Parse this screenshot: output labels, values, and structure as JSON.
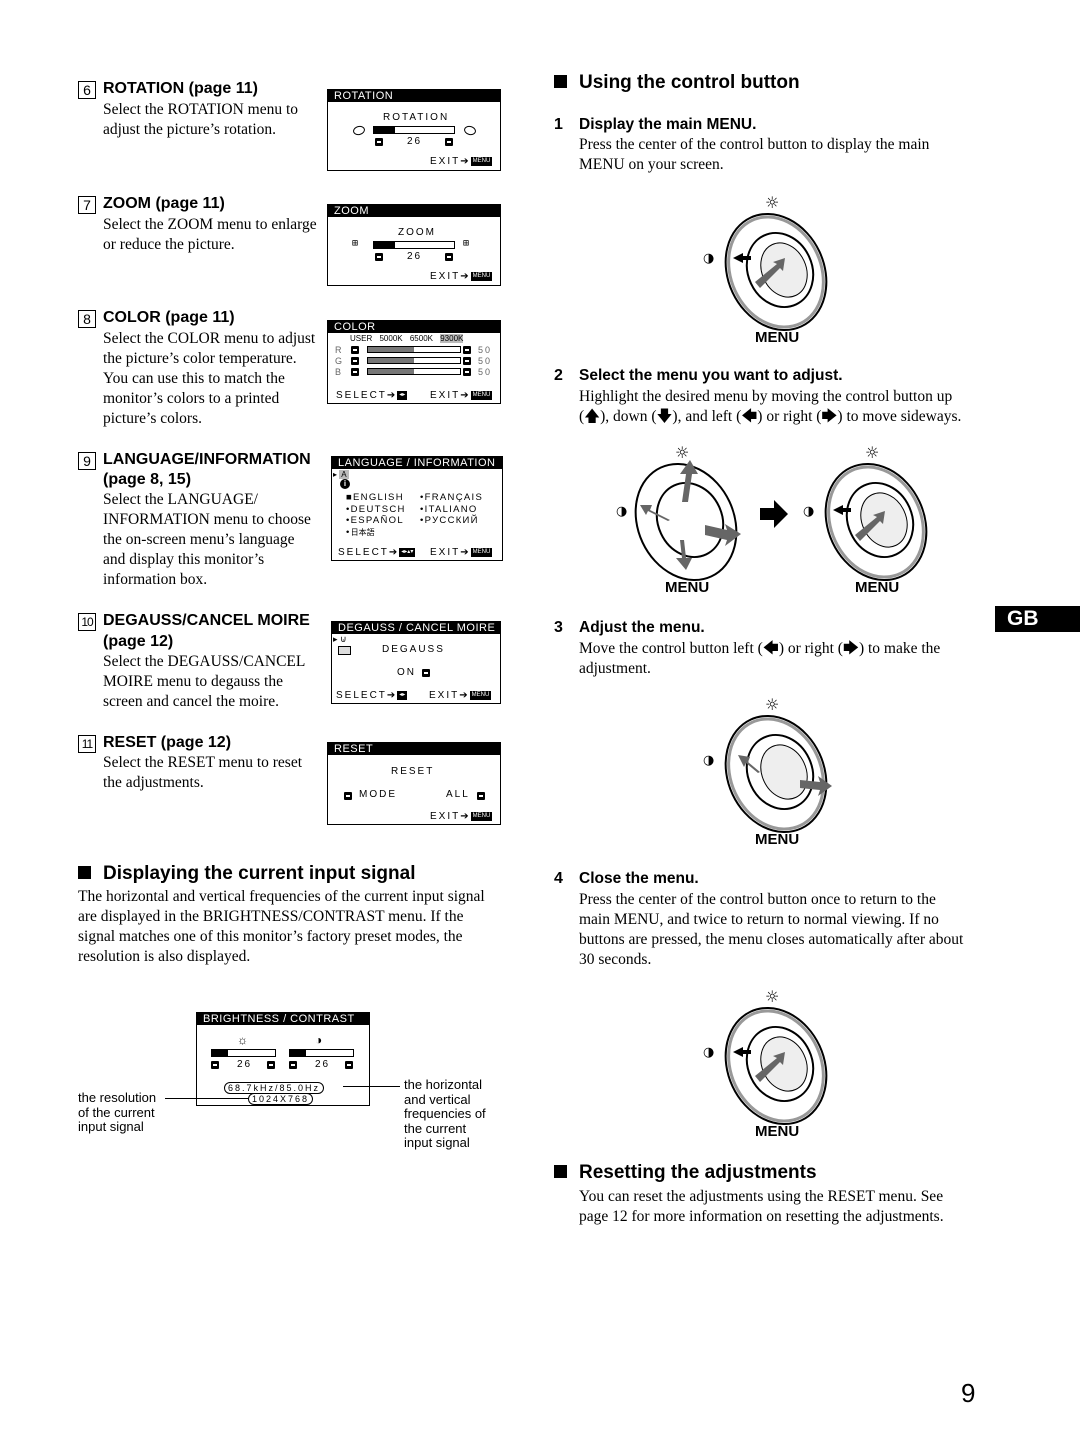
{
  "page": {
    "number": "9",
    "language_tab": "GB"
  },
  "menu_items": [
    {
      "num": "6",
      "title": "ROTATION (page 11)",
      "body": [
        "Select the ROTATION menu to",
        "adjust the picture’s rotation."
      ],
      "osd": {
        "header": "ROTATION",
        "label": "ROTATION",
        "value": "26",
        "level_percent": 26,
        "exit": "EXIT➔",
        "menu_badge": "MENU"
      }
    },
    {
      "num": "7",
      "title": "ZOOM (page 11)",
      "body": [
        "Select the ZOOM menu to enlarge",
        "or reduce the picture."
      ],
      "osd": {
        "header": "ZOOM",
        "label": "ZOOM",
        "value": "26",
        "level_percent": 26,
        "exit": "EXIT➔",
        "menu_badge": "MENU"
      }
    },
    {
      "num": "8",
      "title": "COLOR (page 11)",
      "body": [
        "Select the COLOR menu to adjust",
        "the picture’s color temperature.",
        "You can use this to match the",
        "monitor’s colors to a printed",
        "picture’s colors."
      ],
      "osd": {
        "header": "COLOR",
        "presets": [
          "USER",
          "5000K",
          "6500K",
          "9300K"
        ],
        "selected_preset": "9300K",
        "channels": [
          {
            "name": "R",
            "value": "50",
            "level_percent": 50
          },
          {
            "name": "G",
            "value": "50",
            "level_percent": 50
          },
          {
            "name": "B",
            "value": "50",
            "level_percent": 50
          }
        ],
        "select": "SELECT➔",
        "exit": "EXIT➔",
        "menu_badge": "MENU"
      }
    },
    {
      "num": "9",
      "title": "LANGUAGE/INFORMATION",
      "title2": "(page 8, 15)",
      "body": [
        "Select the LANGUAGE/",
        "INFORMATION menu to choose",
        "the on-screen menu’s language",
        "and display this monitor’s",
        "information box."
      ],
      "osd": {
        "header": "LANGUAGE / INFORMATION",
        "languages": [
          "ENGLISH",
          "FRANÇAIS",
          "DEUTSCH",
          "ITALIANO",
          "ESPAÑOL",
          "РУССКИЙ",
          "日本語"
        ],
        "selected_language": "ENGLISH",
        "select": "SELECT➔",
        "exit": "EXIT➔",
        "menu_badge": "MENU"
      }
    },
    {
      "num": "10",
      "title": "DEGAUSS/CANCEL MOIRE",
      "title2": "(page 12)",
      "body": [
        "Select the DEGAUSS/CANCEL",
        "MOIRE menu to degauss the",
        "screen and cancel the moire."
      ],
      "osd": {
        "header": "DEGAUSS / CANCEL MOIRE",
        "label": "DEGAUSS",
        "value": "ON",
        "select": "SELECT➔",
        "exit": "EXIT➔",
        "menu_badge": "MENU"
      }
    },
    {
      "num": "11",
      "title": "RESET (page 12)",
      "body": [
        "Select the RESET menu to reset",
        "the adjustments."
      ],
      "osd": {
        "header": "RESET",
        "label": "RESET",
        "left_option": "MODE",
        "right_option": "ALL",
        "exit": "EXIT➔",
        "menu_badge": "MENU"
      }
    }
  ],
  "input_signal": {
    "heading": "Displaying the current input signal",
    "body": [
      "The horizontal and vertical frequencies of the current input signal",
      "are displayed in the BRIGHTNESS/CONTRAST menu. If the",
      "signal matches one of this monitor’s factory preset modes, the",
      "resolution is also displayed."
    ],
    "osd": {
      "header": "BRIGHTNESS / CONTRAST",
      "brightness_value": "26",
      "brightness_percent": 26,
      "contrast_value": "26",
      "contrast_percent": 26,
      "frequency": "68.7kHz/85.0Hz",
      "resolution": "1024X768"
    },
    "callout_left": [
      "the resolution",
      "of the current",
      "input signal"
    ],
    "callout_right": [
      "the horizontal",
      "and vertical",
      "frequencies of",
      "the current",
      "input signal"
    ]
  },
  "control_button": {
    "heading": "Using the control button",
    "dial_label": "MENU",
    "steps": [
      {
        "num": "1",
        "title": "Display the main MENU.",
        "body": [
          "Press the center of the control button to display the main",
          "MENU on your screen."
        ]
      },
      {
        "num": "2",
        "title": "Select the menu you want to adjust.",
        "body": [
          "Highlight the desired menu by moving the control button up",
          "(🡅), down (🡇), and left (🡄) or right (🡆) to move sideways."
        ]
      },
      {
        "num": "3",
        "title": "Adjust the menu.",
        "body": [
          "Move the control button left (🡄) or right (🡆) to make the",
          "adjustment."
        ]
      },
      {
        "num": "4",
        "title": "Close the menu.",
        "body": [
          "Press the center of the control button once to return to the",
          "main MENU, and twice to return to normal viewing. If no",
          "buttons are pressed, the menu closes automatically after about",
          "30 seconds."
        ]
      }
    ]
  },
  "resetting": {
    "heading": "Resetting the adjustments",
    "body": [
      "You can reset the adjustments using the RESET menu. See",
      "page 12 for more information on resetting the adjustments."
    ]
  }
}
